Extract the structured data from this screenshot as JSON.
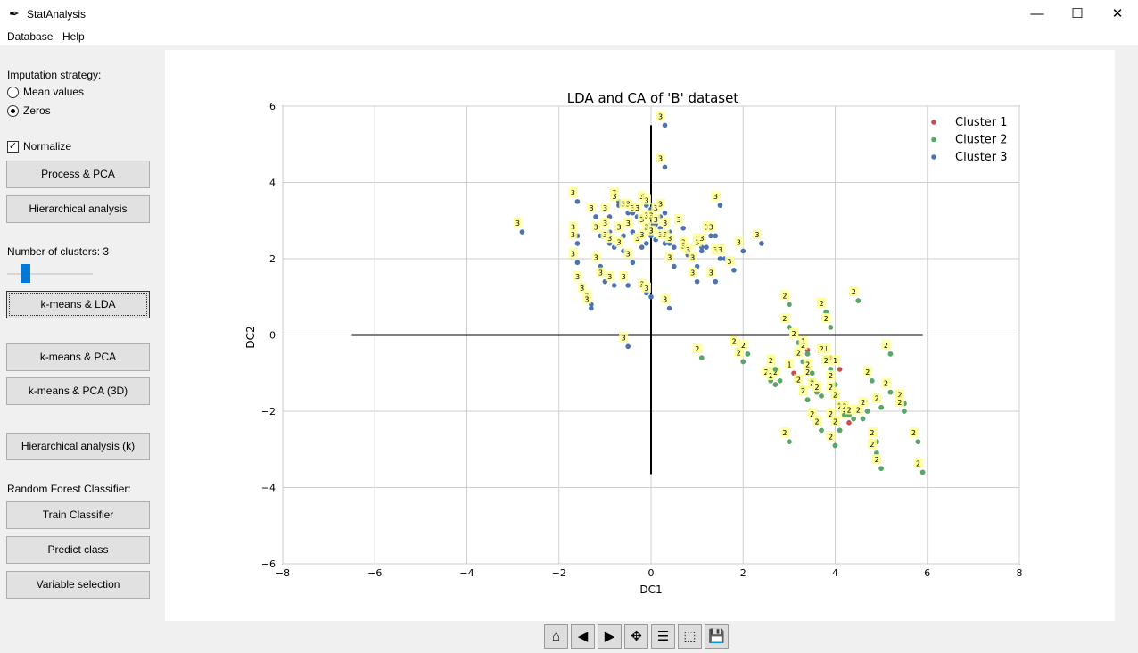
{
  "window": {
    "title": "StatAnalysis",
    "minimize": "—",
    "maximize": "☐",
    "close": "✕"
  },
  "menu": {
    "database": "Database",
    "help": "Help"
  },
  "panel": {
    "imputation_label": "Imputation strategy:",
    "mean_values": "Mean values",
    "zeros": "Zeros",
    "imputation_selected": "Zeros",
    "normalize_label": "Normalize",
    "normalize_checked": true,
    "process_pca": "Process & PCA",
    "hierarchical": "Hierarchical analysis",
    "clusters_label": "Number of clusters: 3",
    "clusters_value": 3,
    "kmeans_lda": "k-means & LDA",
    "kmeans_pca": "k-means & PCA",
    "kmeans_pca3d": "k-means & PCA (3D)",
    "hierarchical_k": "Hierarchical analysis (k)",
    "rf_label": "Random Forest Classifier:",
    "train": "Train Classifier",
    "predict": "Predict class",
    "variable_selection": "Variable selection"
  },
  "toolbar_icons": [
    "home-icon",
    "back-icon",
    "forward-icon",
    "pan-icon",
    "configure-icon",
    "edit-axes-icon",
    "save-icon"
  ],
  "chart_data": {
    "type": "scatter",
    "title": "LDA and CA of 'B' dataset",
    "xlabel": "DC1",
    "ylabel": "DC2",
    "xlim": [
      -8,
      8
    ],
    "ylim": [
      -6,
      6
    ],
    "xticks": [
      -8,
      -6,
      -4,
      -2,
      0,
      2,
      4,
      6,
      8
    ],
    "yticks": [
      -6,
      -4,
      -2,
      0,
      2,
      4,
      6
    ],
    "xtick_labels": [
      "−8",
      "−6",
      "−4",
      "−2",
      "0",
      "2",
      "4",
      "6",
      "8"
    ],
    "ytick_labels": [
      "−6",
      "−4",
      "−2",
      "0",
      "2",
      "4",
      "6"
    ],
    "grid": true,
    "legend_position": "top-right",
    "series": [
      {
        "name": "Cluster 1",
        "label": "1",
        "color": "#c44e52",
        "labels_pts": [],
        "points": [
          [
            1.1,
            -0.6
          ],
          [
            1.9,
            -0.4
          ],
          [
            2.0,
            -0.7
          ],
          [
            2.1,
            -0.5
          ],
          [
            2.6,
            -1.2
          ],
          [
            2.7,
            -1.3
          ],
          [
            2.8,
            -1.2
          ],
          [
            2.7,
            -0.9
          ],
          [
            3.0,
            0.8
          ],
          [
            3.0,
            0.2
          ],
          [
            3.0,
            -2.8
          ],
          [
            3.2,
            -0.2
          ],
          [
            3.3,
            -0.7
          ],
          [
            3.4,
            -0.5
          ],
          [
            3.5,
            -1.2
          ],
          [
            3.3,
            -1.4
          ],
          [
            3.4,
            -1.7
          ],
          [
            3.5,
            -1.0
          ],
          [
            3.6,
            -1.5
          ],
          [
            3.7,
            -1.6
          ],
          [
            3.6,
            -2.3
          ],
          [
            3.7,
            -2.5
          ],
          [
            3.8,
            0.6
          ],
          [
            3.9,
            0.2
          ],
          [
            3.8,
            -0.6
          ],
          [
            3.9,
            -0.9
          ],
          [
            4.0,
            -1.3
          ],
          [
            4.0,
            -1.6
          ],
          [
            4.1,
            -1.8
          ],
          [
            4.0,
            -2.3
          ],
          [
            4.0,
            -2.9
          ],
          [
            4.1,
            -2.5
          ],
          [
            4.2,
            -2.1
          ],
          [
            4.3,
            -2.1
          ],
          [
            4.4,
            -2.2
          ],
          [
            4.5,
            0.9
          ],
          [
            4.6,
            -2.2
          ],
          [
            4.7,
            -2.0
          ],
          [
            4.8,
            -1.2
          ],
          [
            4.9,
            -2.8
          ],
          [
            4.9,
            -3.1
          ],
          [
            5.0,
            -3.5
          ],
          [
            5.0,
            -1.9
          ],
          [
            5.2,
            -0.5
          ],
          [
            5.2,
            -1.5
          ],
          [
            5.5,
            -1.8
          ],
          [
            5.5,
            -2.0
          ],
          [
            5.8,
            -2.8
          ],
          [
            5.9,
            -3.6
          ],
          [
            3.4,
            -0.4
          ],
          [
            3.9,
            -0.6
          ],
          [
            3.1,
            -1.0
          ],
          [
            4.1,
            -0.9
          ],
          [
            4.3,
            -2.3
          ]
        ]
      },
      {
        "name": "Cluster 2",
        "label": "2",
        "color": "#55a868",
        "labels_pts": [],
        "points": [
          [
            1.1,
            -0.6
          ],
          [
            1.9,
            -0.4
          ],
          [
            2.0,
            -0.7
          ],
          [
            2.1,
            -0.5
          ],
          [
            2.6,
            -1.2
          ],
          [
            2.7,
            -1.3
          ],
          [
            2.8,
            -1.2
          ],
          [
            2.7,
            -0.9
          ],
          [
            3.0,
            0.8
          ],
          [
            3.0,
            0.2
          ],
          [
            3.0,
            -2.8
          ],
          [
            3.2,
            -0.2
          ],
          [
            3.3,
            -0.7
          ],
          [
            3.4,
            -0.5
          ],
          [
            3.5,
            -1.2
          ],
          [
            3.3,
            -1.4
          ],
          [
            3.4,
            -1.7
          ],
          [
            3.5,
            -1.0
          ],
          [
            3.6,
            -1.5
          ],
          [
            3.7,
            -1.6
          ],
          [
            3.6,
            -2.3
          ],
          [
            3.7,
            -2.5
          ],
          [
            3.8,
            0.6
          ],
          [
            3.9,
            0.2
          ],
          [
            3.8,
            -0.6
          ],
          [
            3.9,
            -0.9
          ],
          [
            4.0,
            -1.3
          ],
          [
            4.0,
            -1.6
          ],
          [
            4.1,
            -1.8
          ],
          [
            4.0,
            -2.3
          ],
          [
            4.0,
            -2.9
          ],
          [
            4.1,
            -2.5
          ],
          [
            4.2,
            -2.1
          ],
          [
            4.3,
            -2.1
          ],
          [
            4.4,
            -2.2
          ],
          [
            4.5,
            0.9
          ],
          [
            4.6,
            -2.2
          ],
          [
            4.7,
            -2.0
          ],
          [
            4.8,
            -1.2
          ],
          [
            4.9,
            -2.8
          ],
          [
            4.9,
            -3.1
          ],
          [
            5.0,
            -3.5
          ],
          [
            5.0,
            -1.9
          ],
          [
            5.2,
            -0.5
          ],
          [
            5.2,
            -1.5
          ],
          [
            5.5,
            -1.8
          ],
          [
            5.5,
            -2.0
          ],
          [
            5.8,
            -2.8
          ],
          [
            5.9,
            -3.6
          ]
        ]
      },
      {
        "name": "Cluster 3",
        "label": "3",
        "color": "#4c72b0",
        "points": [
          [
            -1.6,
            3.5
          ],
          [
            -1.6,
            2.6
          ],
          [
            -1.6,
            2.4
          ],
          [
            -1.6,
            1.9
          ],
          [
            -1.5,
            1.3
          ],
          [
            -1.4,
            1.0
          ],
          [
            -1.3,
            0.8
          ],
          [
            -1.3,
            0.7
          ],
          [
            -1.2,
            3.1
          ],
          [
            -1.1,
            2.6
          ],
          [
            -1.1,
            1.8
          ],
          [
            -1.0,
            1.4
          ],
          [
            -0.9,
            3.1
          ],
          [
            -0.9,
            2.7
          ],
          [
            -0.9,
            2.4
          ],
          [
            -0.8,
            2.3
          ],
          [
            -0.8,
            1.3
          ],
          [
            -0.7,
            3.5
          ],
          [
            -0.7,
            3.4
          ],
          [
            -0.6,
            2.6
          ],
          [
            -0.6,
            2.2
          ],
          [
            -0.5,
            3.2
          ],
          [
            -0.5,
            1.3
          ],
          [
            -0.4,
            3.2
          ],
          [
            -0.4,
            2.7
          ],
          [
            -0.4,
            1.9
          ],
          [
            -0.3,
            3.1
          ],
          [
            -0.2,
            3.1
          ],
          [
            -0.2,
            2.3
          ],
          [
            -0.1,
            3.4
          ],
          [
            -0.1,
            2.8
          ],
          [
            -0.1,
            2.4
          ],
          [
            -0.1,
            1.1
          ],
          [
            0.0,
            3.3
          ],
          [
            0.0,
            2.9
          ],
          [
            0.0,
            2.6
          ],
          [
            0.0,
            1.0
          ],
          [
            0.1,
            2.9
          ],
          [
            0.1,
            2.5
          ],
          [
            0.2,
            3.1
          ],
          [
            0.2,
            2.8
          ],
          [
            0.3,
            3.2
          ],
          [
            0.3,
            2.4
          ],
          [
            0.4,
            2.7
          ],
          [
            0.4,
            2.4
          ],
          [
            0.5,
            2.3
          ],
          [
            0.5,
            1.8
          ],
          [
            0.7,
            2.8
          ],
          [
            0.8,
            2.2
          ],
          [
            0.8,
            2.1
          ],
          [
            0.9,
            2.0
          ],
          [
            1.0,
            1.8
          ],
          [
            1.0,
            1.4
          ],
          [
            1.1,
            2.3
          ],
          [
            1.1,
            2.2
          ],
          [
            1.2,
            2.3
          ],
          [
            1.3,
            2.6
          ],
          [
            1.4,
            1.4
          ],
          [
            1.4,
            2.6
          ],
          [
            1.5,
            2.0
          ],
          [
            1.5,
            3.4
          ],
          [
            1.6,
            2.0
          ],
          [
            1.8,
            1.7
          ],
          [
            2.0,
            2.2
          ],
          [
            2.4,
            2.4
          ],
          [
            -2.8,
            2.7
          ],
          [
            0.3,
            5.5
          ],
          [
            0.3,
            4.4
          ],
          [
            -0.5,
            -0.3
          ],
          [
            0.4,
            0.7
          ]
        ]
      }
    ]
  }
}
